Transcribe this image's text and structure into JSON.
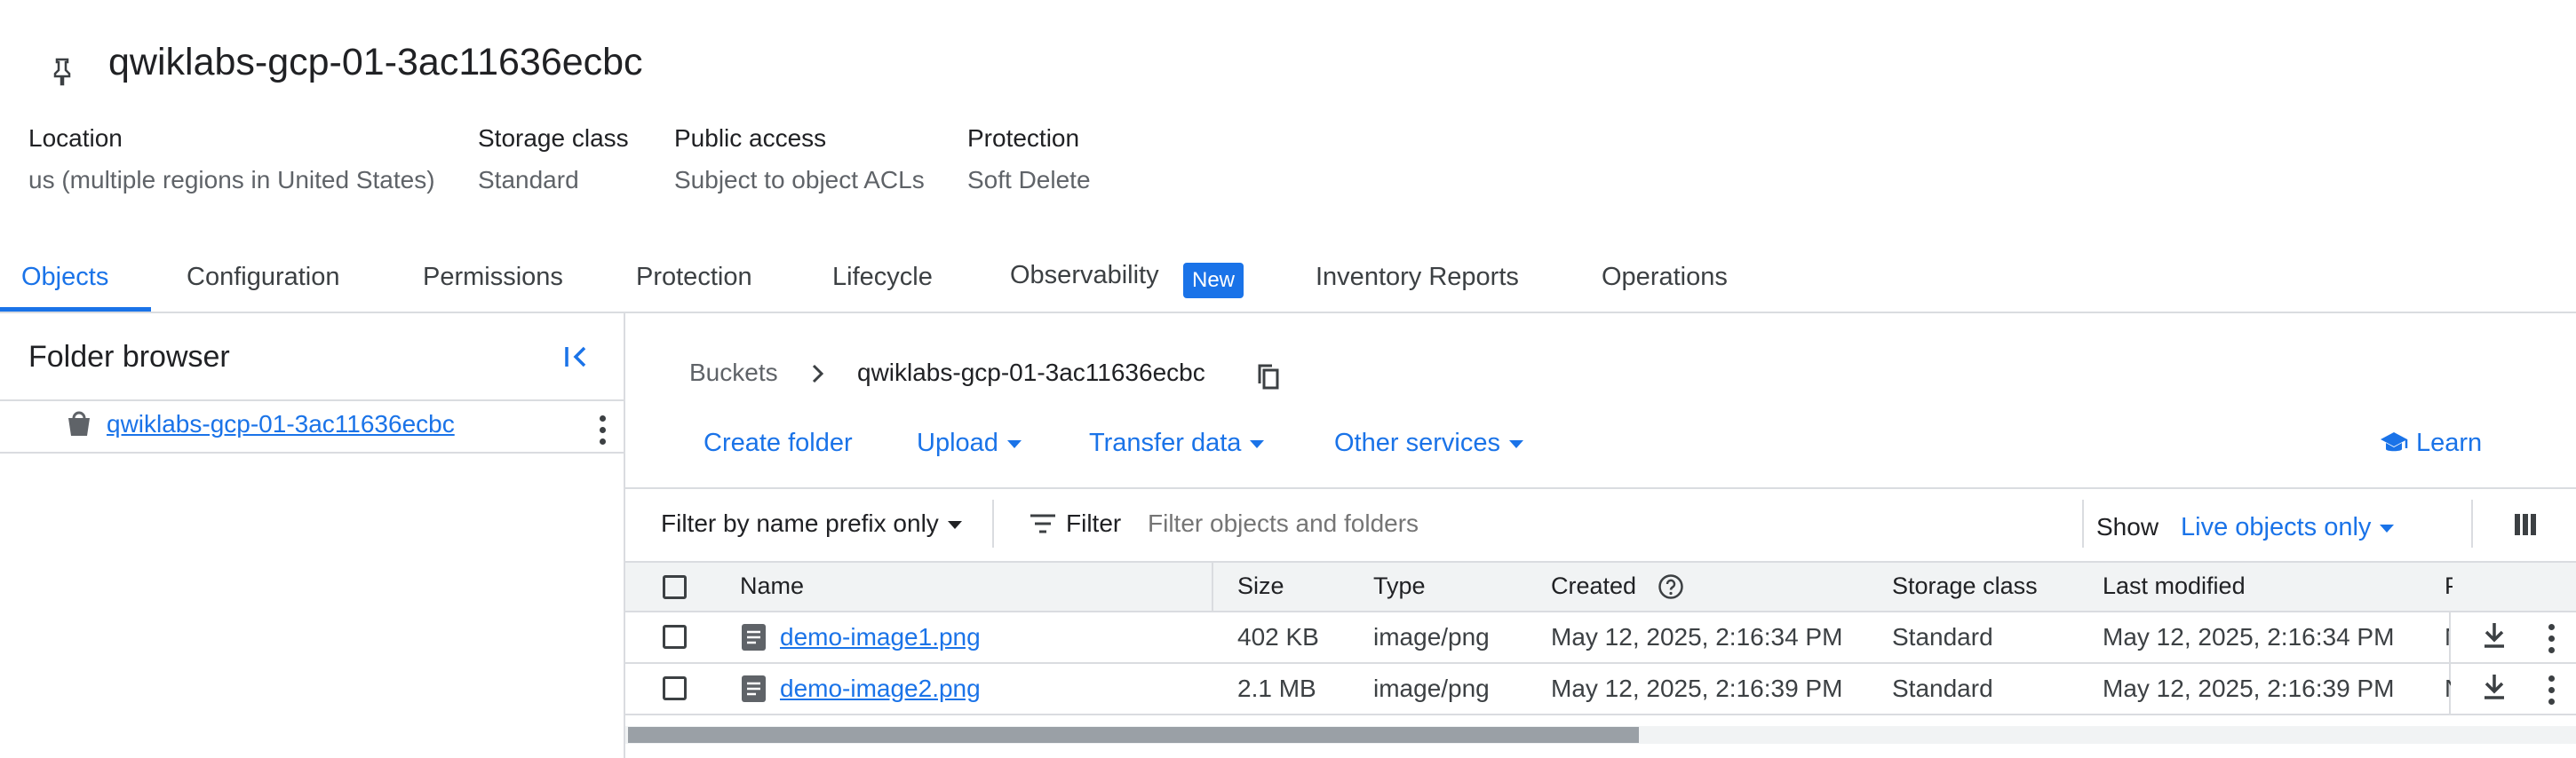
{
  "bucket": {
    "name": "qwiklabs-gcp-01-3ac11636ecbc"
  },
  "info": [
    {
      "label": "Location",
      "value": "us (multiple regions in United States)"
    },
    {
      "label": "Storage class",
      "value": "Standard"
    },
    {
      "label": "Public access",
      "value": "Subject to object ACLs"
    },
    {
      "label": "Protection",
      "value": "Soft Delete"
    }
  ],
  "tabs": [
    {
      "label": "Objects"
    },
    {
      "label": "Configuration"
    },
    {
      "label": "Permissions"
    },
    {
      "label": "Protection"
    },
    {
      "label": "Lifecycle"
    },
    {
      "label": "Observability",
      "badge": "New"
    },
    {
      "label": "Inventory Reports"
    },
    {
      "label": "Operations"
    }
  ],
  "folder_browser": {
    "title": "Folder browser",
    "item": "qwiklabs-gcp-01-3ac11636ecbc"
  },
  "breadcrumb": {
    "root": "Buckets",
    "current": "qwiklabs-gcp-01-3ac11636ecbc"
  },
  "actions": {
    "create_folder": "Create folder",
    "upload": "Upload",
    "transfer": "Transfer data",
    "other": "Other services",
    "learn": "Learn"
  },
  "filter": {
    "prefix_label": "Filter by name prefix only",
    "filter_label": "Filter",
    "placeholder": "Filter objects and folders",
    "show_label": "Show",
    "show_value": "Live objects only"
  },
  "table": {
    "headers": [
      "Name",
      "Size",
      "Type",
      "Created",
      "Storage class",
      "Last modified",
      "P"
    ],
    "rows": [
      {
        "name": "demo-image1.png",
        "size": "402 KB",
        "type": "image/png",
        "created": "May 12, 2025, 2:16:34 PM",
        "storage": "Standard",
        "modified": "May 12, 2025, 2:16:34 PM",
        "extra": "N"
      },
      {
        "name": "demo-image2.png",
        "size": "2.1 MB",
        "type": "image/png",
        "created": "May 12, 2025, 2:16:39 PM",
        "storage": "Standard",
        "modified": "May 12, 2025, 2:16:39 PM",
        "extra": "N"
      }
    ]
  },
  "colors": {
    "accent": "#1a73e8",
    "badge": "#1a73e8",
    "header_bg": "#f1f3f4",
    "border": "#dadce0"
  },
  "scroll": {
    "horizontal_position": 0
  }
}
